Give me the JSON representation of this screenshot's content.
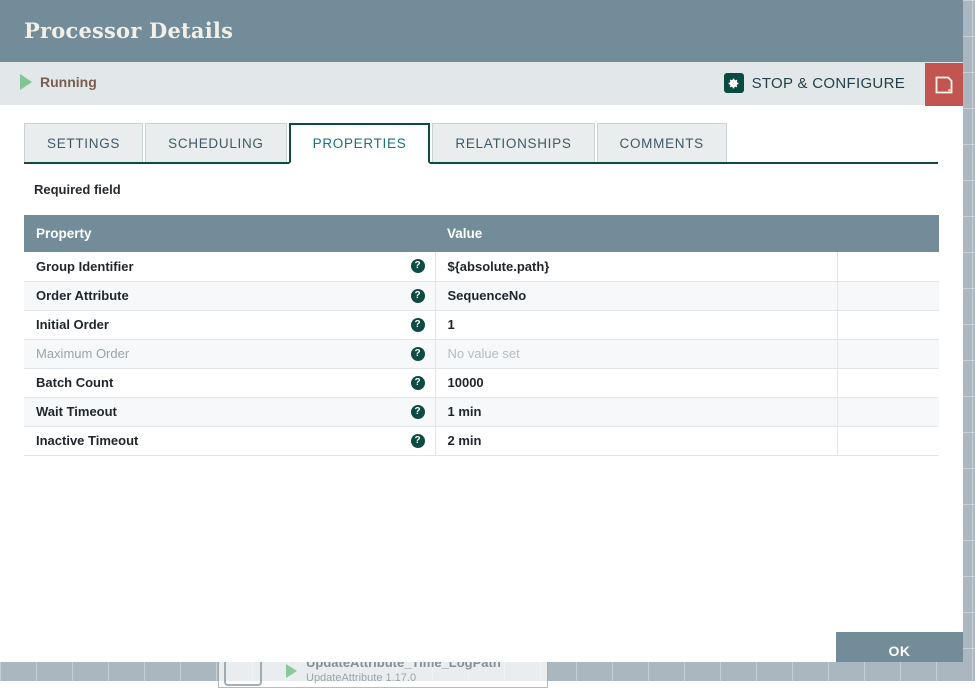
{
  "canvas": {
    "processor_name": "UpdateAttribute_Time_LogPath",
    "processor_type": "UpdateAttribute 1.17.0"
  },
  "dialog": {
    "title": "Processor Details"
  },
  "status_bar": {
    "run_status": "Running",
    "run_icon": "play-icon",
    "stop_configure_label": "STOP & CONFIGURE",
    "gear_icon": "gear-icon",
    "note_icon": "note-icon"
  },
  "tabs": [
    {
      "label": "SETTINGS",
      "active": false
    },
    {
      "label": "SCHEDULING",
      "active": false
    },
    {
      "label": "PROPERTIES",
      "active": true
    },
    {
      "label": "RELATIONSHIPS",
      "active": false
    },
    {
      "label": "COMMENTS",
      "active": false
    }
  ],
  "body": {
    "required_field_label": "Required field",
    "help_glyph": "?"
  },
  "table": {
    "columns": [
      "Property",
      "Value",
      ""
    ],
    "rows": [
      {
        "property": "Group Identifier",
        "value": "${absolute.path}",
        "unset": false
      },
      {
        "property": "Order Attribute",
        "value": "SequenceNo",
        "unset": false
      },
      {
        "property": "Initial Order",
        "value": "1",
        "unset": false
      },
      {
        "property": "Maximum Order",
        "value": "No value set",
        "unset": true
      },
      {
        "property": "Batch Count",
        "value": "10000",
        "unset": false
      },
      {
        "property": "Wait Timeout",
        "value": "1 min",
        "unset": false
      },
      {
        "property": "Inactive Timeout",
        "value": "2 min",
        "unset": false
      }
    ]
  },
  "footer": {
    "ok_label": "OK"
  },
  "colors": {
    "title_bar": "#728d99",
    "accent_teal": "#0d4b43",
    "note_button": "#c25550",
    "running_text": "#7a5c50",
    "run_icon": "#83c492"
  }
}
